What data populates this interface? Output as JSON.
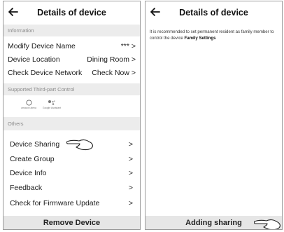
{
  "left_screen": {
    "header": {
      "title": "Details of device",
      "back_icon": "arrow-left-icon"
    },
    "sections": {
      "information": "Information",
      "third_party": "Supported Third-part Control",
      "others": "Others"
    },
    "info_rows": [
      {
        "label": "Modify Device Name",
        "value": "*** >"
      },
      {
        "label": "Device Location",
        "value": "Dining Room >"
      },
      {
        "label": "Check Device Network",
        "value": "Check Now >"
      }
    ],
    "controls": [
      {
        "caption": "amazon alexa",
        "icon": "alexa-ring-icon"
      },
      {
        "caption": "Google Assistant",
        "icon": "google-assistant-icon"
      }
    ],
    "other_rows": [
      {
        "label": "Device Sharing",
        "value": ">"
      },
      {
        "label": "Create Group",
        "value": ">"
      },
      {
        "label": "Device Info",
        "value": ">"
      },
      {
        "label": "Feedback",
        "value": ">"
      },
      {
        "label": "Check for Firmware Update",
        "value": ">"
      }
    ],
    "bottom_button": "Remove Device",
    "pointer_icon": "pointing-hand-icon"
  },
  "right_screen": {
    "header": {
      "title": "Details of device",
      "back_icon": "arrow-left-icon"
    },
    "note_text": "It is recommended to set permanent resident as family member to control the device",
    "note_link": "Family Settings",
    "bottom_button": "Adding sharing",
    "pointer_icon": "pointing-hand-icon"
  },
  "colors": {
    "section_bg": "#ececec",
    "bottom_bar_bg": "#e6e6e6",
    "border": "#9a9a9a"
  }
}
